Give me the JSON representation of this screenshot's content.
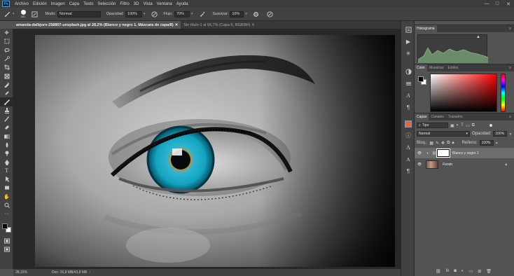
{
  "app": {
    "logo": "Ps"
  },
  "menu": [
    "Archivo",
    "Edición",
    "Imagen",
    "Capa",
    "Texto",
    "Selección",
    "Filtro",
    "3D",
    "Vista",
    "Ventana",
    "Ayuda"
  ],
  "window_controls": {
    "minimize": "—",
    "maximize": "□",
    "close": "✕"
  },
  "options": {
    "brush_size": "361",
    "mode_label": "Modo:",
    "mode_value": "Normal",
    "opacity_label": "Opacidad:",
    "opacity_value": "100%",
    "flow_label": "Flujo:",
    "flow_value": "70%",
    "smooth_label": "Suavizar:",
    "smooth_value": "10%"
  },
  "tabs": [
    {
      "label": "amanda-dalbjorn-258807-unsplash.jpg al 28,2% (Blanco y negro 1, Máscara de capa/8)",
      "close": "✕"
    },
    {
      "label": "Sin título-1 al 66,7% (Capa 5, RGB/8#)",
      "close": "✕"
    }
  ],
  "status": {
    "zoom": "28,16%",
    "doc": "Doc: 26,8 MB/43,8 MB"
  },
  "histogram": {
    "title": "Histograma",
    "warning": "▲"
  },
  "color_panel": {
    "tabs": [
      "Color",
      "Muestras",
      "Estilos"
    ]
  },
  "layers_panel": {
    "tabs": [
      "Capas",
      "Canales",
      "Trazados"
    ],
    "filter_label": "Tipo",
    "blend_mode": "Normal",
    "opacity_label": "Opacidad:",
    "opacity_value": "100%",
    "lock_label": "Bloq.:",
    "fill_label": "Relleno:",
    "fill_value": "100%",
    "layers": [
      {
        "name": "Blanco y negro 1",
        "selected": true
      },
      {
        "name": "Fondo",
        "selected": false
      }
    ]
  },
  "colors": {
    "accent": "#31a8ff",
    "iris": "#12a4c0",
    "iris_dark": "#074a5c",
    "iris_orange": "#d9872a"
  }
}
